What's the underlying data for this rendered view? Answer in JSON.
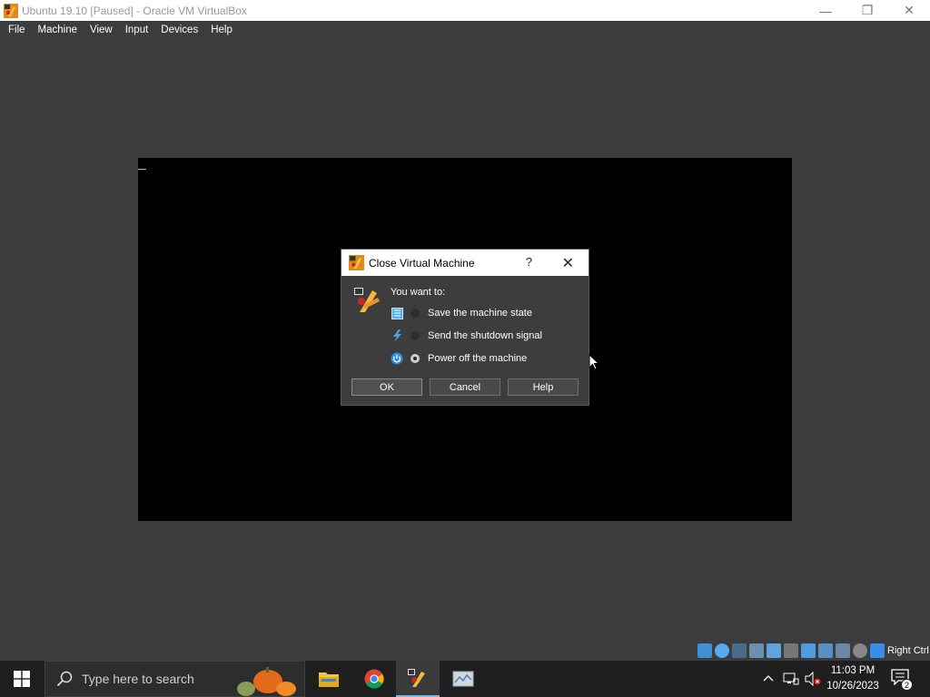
{
  "window": {
    "title": "Ubuntu 19.10 [Paused] - Oracle VM VirtualBox",
    "minimize_glyph": "—",
    "restore_glyph": "❐",
    "close_glyph": "✕"
  },
  "menubar": {
    "items": [
      "File",
      "Machine",
      "View",
      "Input",
      "Devices",
      "Help"
    ]
  },
  "dialog": {
    "title": "Close Virtual Machine",
    "help_glyph": "?",
    "close_glyph": "✕",
    "prompt": "You want to:",
    "options": [
      {
        "label": "Save the machine state",
        "icon": "save-state-icon",
        "selected": false
      },
      {
        "label": "Send the shutdown signal",
        "icon": "shutdown-signal-icon",
        "selected": false
      },
      {
        "label": "Power off the machine",
        "icon": "power-off-icon",
        "selected": true
      }
    ],
    "buttons": {
      "ok": "OK",
      "cancel": "Cancel",
      "help": "Help"
    }
  },
  "statusbar": {
    "host_key": "Right Ctrl"
  },
  "taskbar": {
    "search_placeholder": "Type here to search",
    "clock_time": "11:03 PM",
    "clock_date": "10/26/2023",
    "notification_count": "2"
  },
  "colors": {
    "background": "#3b3c3d",
    "vm_screen": "#000000",
    "taskbar": "#1f1f1f",
    "accent": "#76b9ed"
  }
}
